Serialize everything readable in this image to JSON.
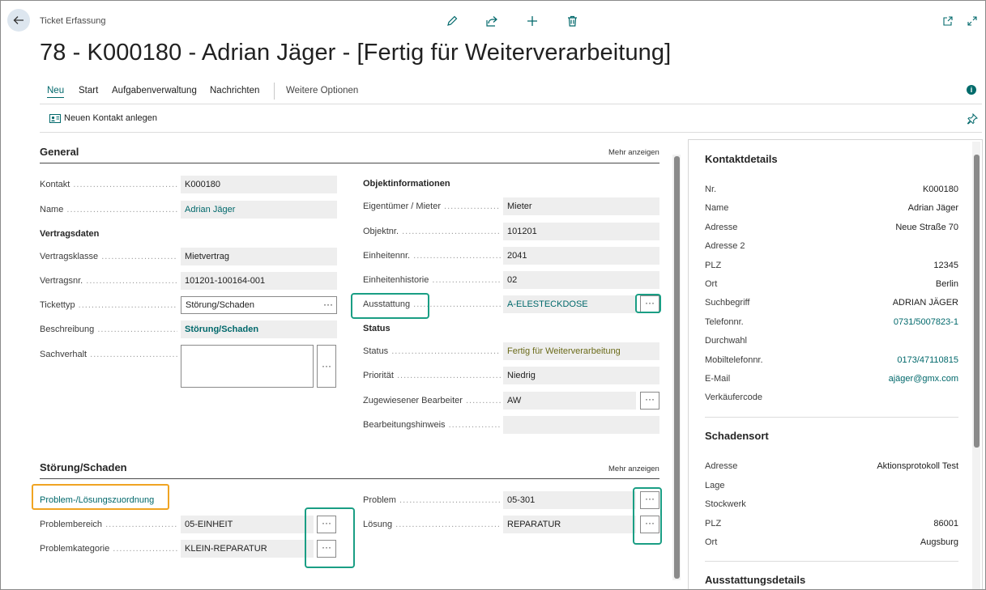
{
  "header": {
    "breadcrumb": "Ticket Erfassung",
    "title": "78 - K000180 - Adrian Jäger - [Fertig für Weiterverarbeitung]"
  },
  "menu": {
    "items": [
      "Neu",
      "Start",
      "Aufgabenverwaltung",
      "Nachrichten"
    ],
    "more_options": "Weitere Optionen",
    "action_new_contact": "Neuen Kontakt anlegen"
  },
  "general": {
    "title": "General",
    "show_more": "Mehr anzeigen",
    "left": {
      "kontakt": {
        "label": "Kontakt",
        "value": "K000180"
      },
      "name": {
        "label": "Name",
        "value": "Adrian Jäger"
      },
      "vertragsdaten_title": "Vertragsdaten",
      "vertragsklasse": {
        "label": "Vertragsklasse",
        "value": "Mietvertrag"
      },
      "vertragsnr": {
        "label": "Vertragsnr.",
        "value": "101201-100164-001"
      },
      "tickettyp": {
        "label": "Tickettyp",
        "value": "Störung/Schaden"
      },
      "beschreibung": {
        "label": "Beschreibung",
        "value": "Störung/Schaden"
      },
      "sachverhalt": {
        "label": "Sachverhalt",
        "value": ""
      }
    },
    "right": {
      "objekt_title": "Objektinformationen",
      "eigentuemer": {
        "label": "Eigentümer / Mieter",
        "value": "Mieter"
      },
      "objektnr": {
        "label": "Objektnr.",
        "value": "101201"
      },
      "einheitennr": {
        "label": "Einheitennr.",
        "value": "2041"
      },
      "einheitenhistorie": {
        "label": "Einheitenhistorie",
        "value": "02"
      },
      "ausstattung": {
        "label": "Ausstattung",
        "value": "A-ELESTECKDOSE"
      },
      "status_title": "Status",
      "status": {
        "label": "Status",
        "value": "Fertig für Weiterverarbeitung"
      },
      "prioritaet": {
        "label": "Priorität",
        "value": "Niedrig"
      },
      "bearbeiter": {
        "label": "Zugewiesener Bearbeiter",
        "value": "AW"
      },
      "hinweis": {
        "label": "Bearbeitungshinweis",
        "value": ""
      }
    }
  },
  "stoerung": {
    "title": "Störung/Schaden",
    "show_more": "Mehr anzeigen",
    "link": "Problem-/Lösungszuordnung",
    "problembereich": {
      "label": "Problembereich",
      "value": "05-EINHEIT"
    },
    "problemkategorie": {
      "label": "Problemkategorie",
      "value": "KLEIN-REPARATUR"
    },
    "problem": {
      "label": "Problem",
      "value": "05-301"
    },
    "loesung": {
      "label": "Lösung",
      "value": "REPARATUR"
    }
  },
  "factbox": {
    "kontakt_title": "Kontaktdetails",
    "kontakt_rows": [
      {
        "k": "Nr.",
        "v": "K000180"
      },
      {
        "k": "Name",
        "v": "Adrian Jäger"
      },
      {
        "k": "Adresse",
        "v": "Neue Straße 70"
      },
      {
        "k": "Adresse 2",
        "v": ""
      },
      {
        "k": "PLZ",
        "v": "12345"
      },
      {
        "k": "Ort",
        "v": "Berlin"
      },
      {
        "k": "Suchbegriff",
        "v": "ADRIAN JÄGER"
      },
      {
        "k": "Telefonnr.",
        "v": "0731/5007823-1"
      },
      {
        "k": "Durchwahl",
        "v": ""
      },
      {
        "k": "Mobiltelefonnr.",
        "v": "0173/47110815"
      },
      {
        "k": "E-Mail",
        "v": "ajäger@gmx.com"
      },
      {
        "k": "Verkäufercode",
        "v": ""
      }
    ],
    "schaden_title": "Schadensort",
    "schaden_rows": [
      {
        "k": "Adresse",
        "v": "Aktionsprotokoll Test"
      },
      {
        "k": "Lage",
        "v": ""
      },
      {
        "k": "Stockwerk",
        "v": ""
      },
      {
        "k": "PLZ",
        "v": "86001"
      },
      {
        "k": "Ort",
        "v": "Augsburg"
      }
    ],
    "ausstattung_title": "Ausstattungsdetails"
  },
  "icons": [
    "back-arrow-icon",
    "edit-pencil-icon",
    "share-icon",
    "add-plus-icon",
    "delete-trash-icon",
    "open-new-window-icon",
    "expand-icon",
    "info-icon",
    "contact-card-icon",
    "pin-icon",
    "ellipsis-icon"
  ],
  "colors": {
    "accent": "#00686b",
    "highlight_green": "#1a9e84",
    "highlight_orange": "#f0a422"
  }
}
